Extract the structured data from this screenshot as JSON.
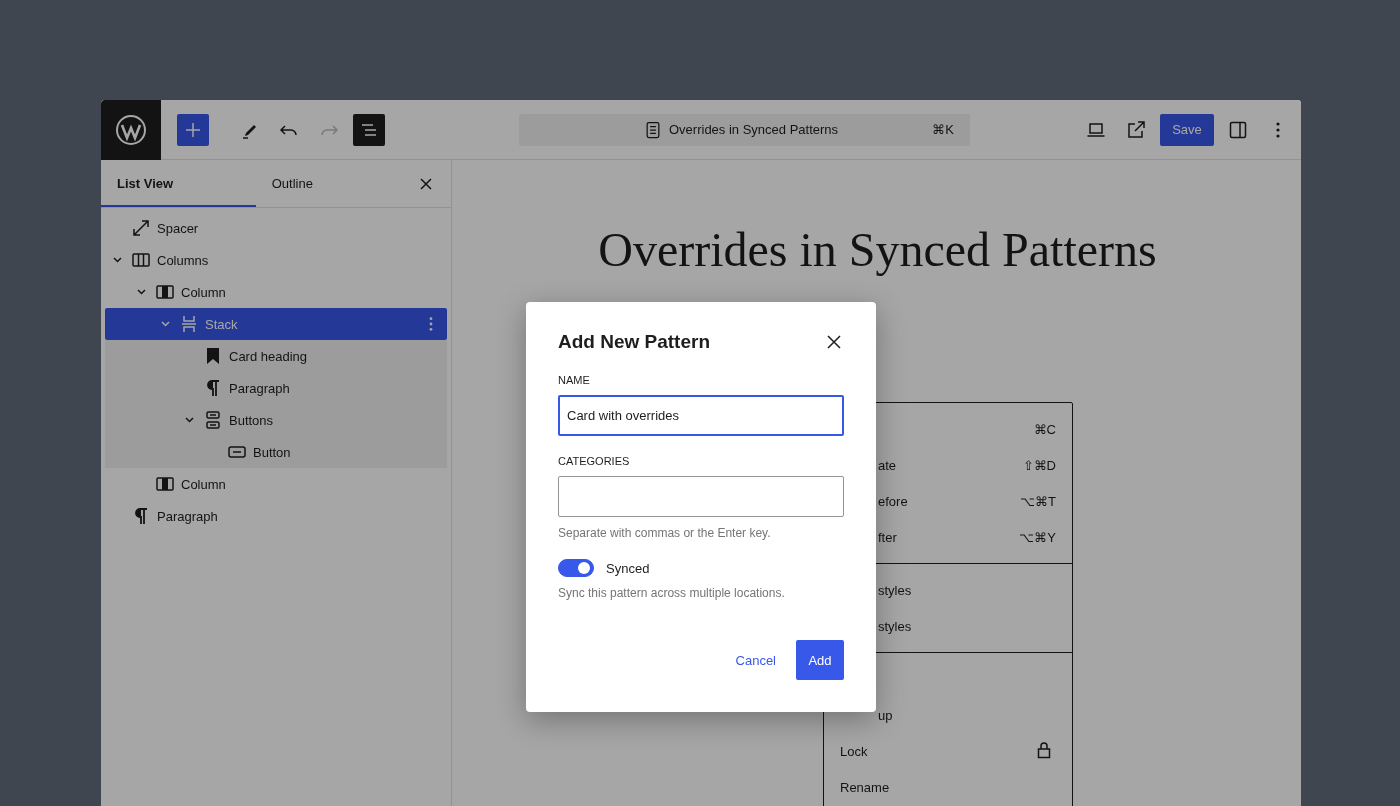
{
  "topbar": {
    "tools": [
      {
        "kind": "inserter",
        "disabled": false,
        "pressed": false
      },
      {
        "kind": "tools",
        "disabled": false,
        "pressed": false
      },
      {
        "kind": "undo",
        "disabled": false,
        "pressed": false
      },
      {
        "kind": "redo",
        "disabled": true,
        "pressed": false
      },
      {
        "kind": "listview",
        "disabled": false,
        "pressed": true
      }
    ],
    "document_bar": {
      "title": "Overrides in Synced Patterns",
      "shortcut": "⌘K"
    },
    "save_button": "Save"
  },
  "sidebar": {
    "tabs": [
      {
        "label": "List View",
        "selected": true
      },
      {
        "label": "Outline",
        "selected": false
      }
    ],
    "tree": [
      {
        "label": "Spacer",
        "kind": "spacer",
        "selected": false
      },
      {
        "label": "Columns",
        "kind": "columns",
        "selected": false,
        "expanded": true,
        "children": [
          {
            "label": "Column",
            "kind": "column",
            "selected": false,
            "expanded": true,
            "children": [
              {
                "label": "Stack",
                "kind": "stack",
                "selected": true,
                "expanded": true,
                "children": [
                  {
                    "label": "Card heading",
                    "kind": "heading",
                    "selected": false
                  },
                  {
                    "label": "Paragraph",
                    "kind": "paragraph",
                    "selected": false
                  },
                  {
                    "label": "Buttons",
                    "kind": "buttons",
                    "selected": false,
                    "expanded": true,
                    "children": [
                      {
                        "label": "Button",
                        "kind": "button",
                        "selected": false
                      }
                    ]
                  }
                ]
              }
            ]
          },
          {
            "label": "Column",
            "kind": "column",
            "selected": false
          }
        ]
      },
      {
        "label": "Paragraph",
        "kind": "paragraph",
        "selected": false
      }
    ]
  },
  "canvas": {
    "heading": "Overrides in Synced Patterns"
  },
  "block_menu": {
    "groups": [
      {
        "items": [
          {
            "kind": "shortcut",
            "shortcut": "⌘C"
          },
          {
            "kind": "shortcut",
            "label": "ate",
            "clipped": true,
            "shortcut": "⇧⌘D"
          },
          {
            "kind": "shortcut",
            "label": "efore",
            "clipped": true,
            "shortcut": "⌥⌘T"
          },
          {
            "kind": "shortcut",
            "label": "fter",
            "clipped": true,
            "shortcut": "⌥⌘Y"
          }
        ]
      },
      {
        "items": [
          {
            "kind": "plain",
            "label": "styles",
            "clipped": true
          },
          {
            "kind": "plain",
            "label": "styles",
            "clipped": true
          }
        ]
      },
      {
        "items": [
          {
            "kind": "plain",
            "label": "up",
            "clipped": true
          },
          {
            "kind": "lock",
            "label": "Lock",
            "clipped": false
          },
          {
            "kind": "plain",
            "label": "Rename",
            "clipped": false
          }
        ]
      }
    ]
  },
  "modal": {
    "title": "Add New Pattern",
    "fields": [
      {
        "label": "NAME",
        "value": "Card with overrides",
        "focused": true
      },
      {
        "label": "CATEGORIES",
        "focused": false,
        "help": "Separate with commas or the Enter key."
      }
    ],
    "toggle": {
      "label": "Synced",
      "on": true,
      "help": "Sync this pattern across multiple locations."
    },
    "buttons": [
      {
        "label": "Cancel",
        "kind": "tertiary"
      },
      {
        "label": "Add",
        "kind": "primary"
      }
    ]
  }
}
